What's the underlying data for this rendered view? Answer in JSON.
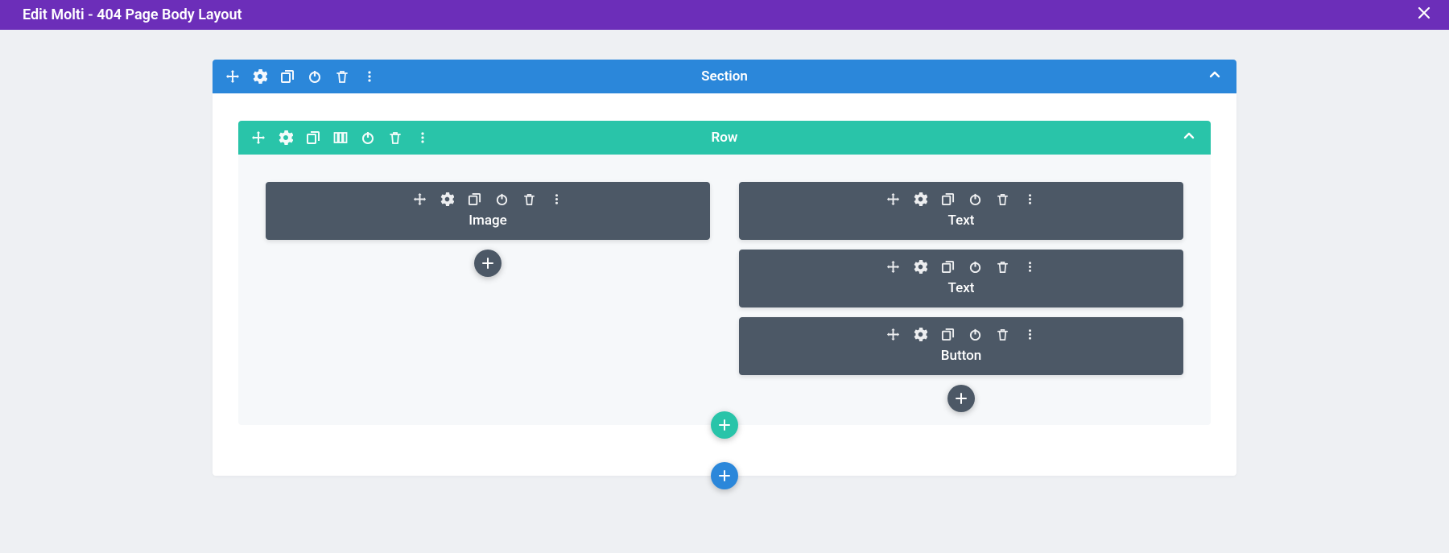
{
  "colors": {
    "purple": "#6c2eb9",
    "blue": "#2b87da",
    "green": "#29c4a9",
    "module": "#4c5866",
    "canvas": "#eef0f3"
  },
  "top_bar": {
    "title": "Edit Molti - 404 Page Body Layout"
  },
  "section": {
    "label": "Section",
    "row": {
      "label": "Row",
      "columns": [
        {
          "modules": [
            {
              "type": "Image"
            }
          ]
        },
        {
          "modules": [
            {
              "type": "Text"
            },
            {
              "type": "Text"
            },
            {
              "type": "Button"
            }
          ]
        }
      ]
    }
  },
  "icons": {
    "move": "move-icon",
    "settings": "gear-icon",
    "duplicate": "duplicate-icon",
    "columns": "columns-icon",
    "power": "power-icon",
    "delete": "trash-icon",
    "more": "more-icon",
    "collapse": "chevron-up-icon",
    "close": "close-icon",
    "add": "plus-icon"
  }
}
